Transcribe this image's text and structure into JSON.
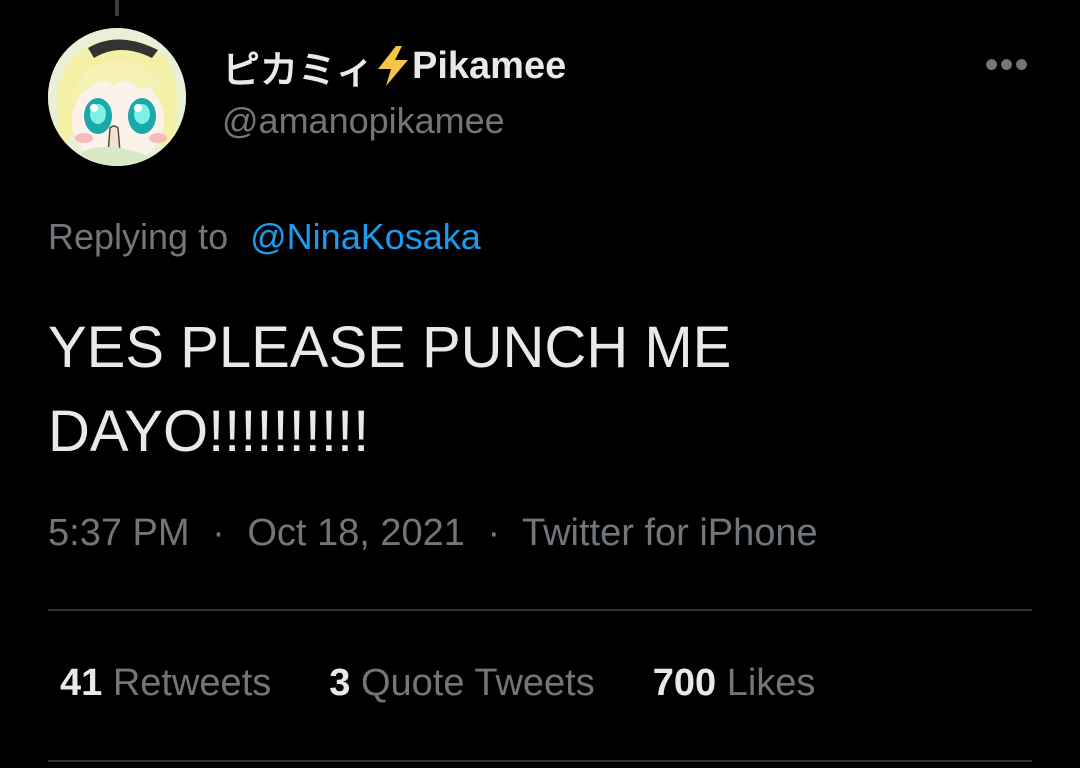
{
  "author": {
    "display_name": "ピカミィ",
    "display_name_suffix": "Pikamee",
    "name_emoji": "⚡",
    "handle": "@amanopikamee",
    "avatar_icon": "anime-avatar"
  },
  "more_icon": "more-icon",
  "more_glyph": "•••",
  "reply": {
    "prefix": "Replying to",
    "mention": "@NinaKosaka"
  },
  "tweet": {
    "text": "YES PLEASE PUNCH ME\nDAYO!!!!!!!!!!"
  },
  "meta": {
    "time": "5:37 PM",
    "date": "Oct 18, 2021",
    "source": "Twitter for iPhone",
    "separator": "·"
  },
  "stats": [
    {
      "count": "41",
      "label": "Retweets"
    },
    {
      "count": "3",
      "label": "Quote Tweets"
    },
    {
      "count": "700",
      "label": "Likes"
    }
  ],
  "colors": {
    "background": "#000000",
    "primary_text": "#e7e9ea",
    "secondary_text": "#71767b",
    "link": "#1d9bf0",
    "bolt": "#f6c443"
  }
}
